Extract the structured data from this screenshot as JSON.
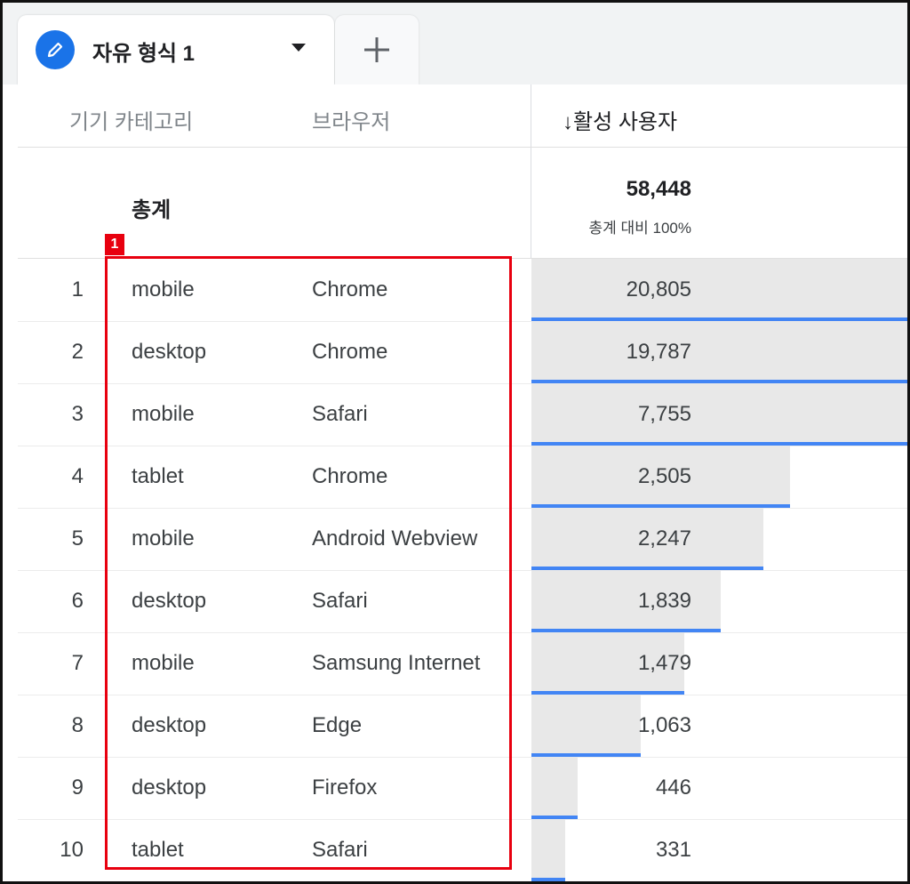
{
  "tab": {
    "title": "자유 형식 1"
  },
  "headers": {
    "device": "기기 카테고리",
    "browser": "브라우저",
    "metric": "↓활성 사용자"
  },
  "total": {
    "label": "총계",
    "value": "58,448",
    "sub": "총계 대비 100%"
  },
  "highlight": {
    "badge": "1"
  },
  "colors": {
    "accent": "#1a73e8",
    "bar_line": "#4285f4",
    "bar_fill": "#e8e8e8",
    "highlight": "#e8000f"
  },
  "rows": [
    {
      "index": "1",
      "device": "mobile",
      "browser": "Chrome",
      "value": "20,805",
      "num": 20805
    },
    {
      "index": "2",
      "device": "desktop",
      "browser": "Chrome",
      "value": "19,787",
      "num": 19787
    },
    {
      "index": "3",
      "device": "mobile",
      "browser": "Safari",
      "value": "7,755",
      "num": 7755
    },
    {
      "index": "4",
      "device": "tablet",
      "browser": "Chrome",
      "value": "2,505",
      "num": 2505
    },
    {
      "index": "5",
      "device": "mobile",
      "browser": "Android Webview",
      "value": "2,247",
      "num": 2247
    },
    {
      "index": "6",
      "device": "desktop",
      "browser": "Safari",
      "value": "1,839",
      "num": 1839
    },
    {
      "index": "7",
      "device": "mobile",
      "browser": "Samsung Internet",
      "value": "1,479",
      "num": 1479
    },
    {
      "index": "8",
      "device": "desktop",
      "browser": "Edge",
      "value": "1,063",
      "num": 1063
    },
    {
      "index": "9",
      "device": "desktop",
      "browser": "Firefox",
      "value": "446",
      "num": 446
    },
    {
      "index": "10",
      "device": "tablet",
      "browser": "Safari",
      "value": "331",
      "num": 331
    }
  ]
}
